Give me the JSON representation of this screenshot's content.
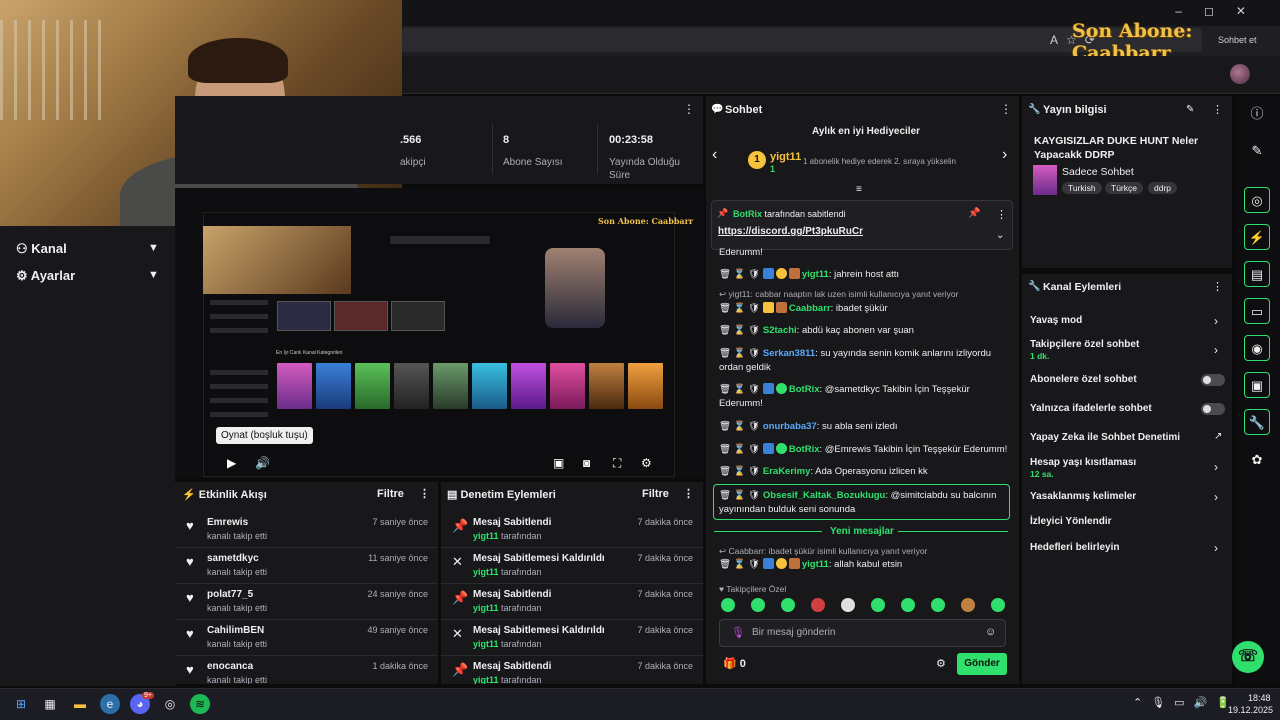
{
  "overlay": {
    "sub_text": "Son Abone: Caabbarr",
    "sohbet_et": "Sohbet et"
  },
  "sidebar": {
    "items": [
      {
        "label": "Kanal"
      },
      {
        "label": "Ayarlar"
      }
    ]
  },
  "stats": [
    {
      "value": ".566",
      "label": "akipçi"
    },
    {
      "value": "8",
      "label": "Abone Sayısı"
    },
    {
      "value": "00:23:58",
      "label": "Yayında Olduğu Süre"
    }
  ],
  "video": {
    "tooltip": "Oynat (boşluk tuşu)",
    "overlay_text": "Son Abone: Caabbarr",
    "category_title": "En İyi Canlı Kanal Kategorileri"
  },
  "activity": {
    "title": "Etkinlik Akışı",
    "filter": "Filtre",
    "items": [
      {
        "name": "Emrewis",
        "sub": "kanalı takip etti",
        "time": "7 saniye önce"
      },
      {
        "name": "sametdkyc",
        "sub": "kanalı takip etti",
        "time": "11 saniye önce"
      },
      {
        "name": "polat77_5",
        "sub": "kanalı takip etti",
        "time": "24 saniye önce"
      },
      {
        "name": "CahilimBEN",
        "sub": "kanalı takip etti",
        "time": "49 saniye önce"
      },
      {
        "name": "enocanca",
        "sub": "kanalı takip etti",
        "time": "1 dakika önce"
      }
    ]
  },
  "moderation": {
    "title": "Denetim Eylemleri",
    "filter": "Filtre",
    "items": [
      {
        "name": "Mesaj Sabitlendi",
        "user": "yigt11",
        "suffix": "tarafından",
        "time": "7 dakika önce"
      },
      {
        "name": "Mesaj Sabitlemesi Kaldırıldı",
        "user": "yigt11",
        "suffix": "tarafından",
        "time": "7 dakika önce"
      },
      {
        "name": "Mesaj Sabitlendi",
        "user": "yigt11",
        "suffix": "tarafından",
        "time": "7 dakika önce"
      },
      {
        "name": "Mesaj Sabitlemesi Kaldırıldı",
        "user": "yigt11",
        "suffix": "tarafından",
        "time": "7 dakika önce"
      },
      {
        "name": "Mesaj Sabitlendi",
        "user": "yigt11",
        "suffix": "tarafından",
        "time": "7 dakika önce"
      }
    ]
  },
  "chat": {
    "title": "Sohbet",
    "hype_title": "Aylık en iyi Hediyeciler",
    "hype_rank": "1",
    "hype_user": "yigt11",
    "hype_count": "1",
    "hype_desc": "1 abonelik hediye ederek 2. sıraya yükselin",
    "pinned_by": "BotRix",
    "pinned_by_suffix": "tarafından sabitlendi",
    "pinned_link": "https://discord.gg/Pt3pkuRuCr",
    "partial": "Ederumm!",
    "messages": [
      {
        "user": "yigt11",
        "color": "#2fe06d",
        "text": ": jahrein host attı"
      },
      {
        "reply": "yigt11: cabbar naaptın lak uzen isimli kullanıcıya yanıt veriyor"
      },
      {
        "user": "Caabbarr",
        "color": "#2fe06d",
        "text": ": ibadet şükür"
      },
      {
        "user": "S2tachi",
        "color": "#2fe06d",
        "text": ": abdü kaç abonen var şuan"
      },
      {
        "user": "Serkan3811",
        "color": "#5aa9ff",
        "text": ": su yayında senin komik anlarını izliyordu ordan geldik"
      },
      {
        "user": "BotRix",
        "color": "#2fe06d",
        "text": ": @sametdkyc Takibin İçin Teşşekür Ederumm!"
      },
      {
        "user": "onurbaba37",
        "color": "#5aa9ff",
        "text": ": su abla seni izledı"
      },
      {
        "user": "BotRix",
        "color": "#2fe06d",
        "text": ": @Emrewis Takibin İçin Teşşekür Ederumm!"
      },
      {
        "user": "EraKerimy",
        "color": "#2fe06d",
        "text": ": Ada Operasyonu izlicen kk"
      },
      {
        "user": "Obsesif_Kaltak_Bozuklugu",
        "color": "#2fe06d",
        "text": ": @simitciabdu su balcının yayınından bulduk seni sonunda"
      }
    ],
    "new_messages_label": "Yeni mesajlar",
    "after_reply": "Caabbarr: ibadet şükür isimli kullanıcıya yanıt veriyor",
    "after_msg": {
      "user": "yigt11",
      "text": ": allah kabul etsin"
    },
    "emote_label": "Takipçilere Özel",
    "input_placeholder": "Bir mesaj gönderin",
    "points": "0",
    "send_label": "Gönder"
  },
  "stream_info": {
    "title": "Yayın bilgisi",
    "stream_title": "KAYGISIZLAR DUKE HUNT Neler Yapacakk DDRP",
    "category": "Sadece Sohbet",
    "tags": [
      "Turkish",
      "Türkçe",
      "ddrp"
    ]
  },
  "actions": {
    "title": "Kanal Eylemleri",
    "items": [
      {
        "label": "Yavaş mod",
        "sub": "",
        "control": "chevron"
      },
      {
        "label": "Takipçilere özel sohbet",
        "sub": "1 dk.",
        "control": "chevron"
      },
      {
        "label": "Abonelere özel sohbet",
        "sub": "",
        "control": "toggle"
      },
      {
        "label": "Yalnızca ifadelerle sohbet",
        "sub": "",
        "control": "toggle"
      },
      {
        "label": "Yapay Zeka ile Sohbet Denetimi",
        "sub": "",
        "control": "external"
      },
      {
        "label": "Hesap yaşı kısıtlaması",
        "sub": "12 sa.",
        "control": "chevron"
      },
      {
        "label": "Yasaklanmış kelimeler",
        "sub": "",
        "control": "chevron"
      },
      {
        "label": "İzleyici Yönlendir",
        "sub": "",
        "control": "none"
      },
      {
        "label": "Hedefleri belirleyin",
        "sub": "",
        "control": "chevron"
      }
    ]
  },
  "taskbar": {
    "time": "18:48",
    "date": "19.12.2025",
    "badge": "9+"
  }
}
